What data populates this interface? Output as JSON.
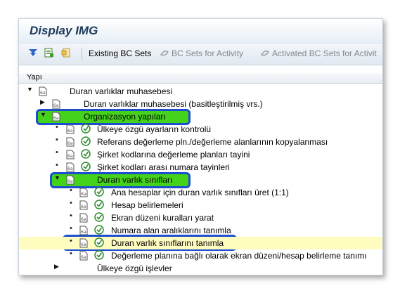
{
  "window": {
    "title": "Display IMG"
  },
  "toolbar": {
    "existing_bc_sets": "Existing BC Sets",
    "bc_sets_for_activity": "BC Sets for Activity",
    "activated_bc_sets": "Activated BC Sets for Activit"
  },
  "column_header": "Yapı",
  "tree": {
    "root": "Duran varlıklar muhasebesi",
    "item_simplified": "Duran varlıklar muhasebesi (basitleştirilmiş vrs.)",
    "org": "Organizasyon yapıları",
    "org_children": [
      "Ülkeye özgü ayarların kontrolü",
      "Referans değerleme pln./değerleme alanlarının kopyalanması",
      "Şirket kodlarına değerleme planları tayini",
      "Şirket kodları arası numara tayinleri"
    ],
    "classes": "Duran varlık sınıfları",
    "class_children": [
      "Ana hesaplar için duran varlık sınıfları üret (1:1)",
      "Hesap belirlemeleri",
      "Ekran düzeni kuralları yarat",
      "Numara alan aralıklarını tanımla",
      "Duran varlık sınıflarını tanımla",
      "Değerleme planına bağlı olarak ekran düzeni/hesap belirleme tanımı"
    ],
    "country_specific": "Ülkeye özgü işlevler"
  }
}
